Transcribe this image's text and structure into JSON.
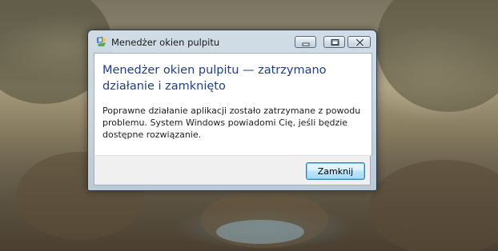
{
  "dialog": {
    "title": "Menedżer okien pulpitu",
    "heading": "Menedżer okien pulpitu — zatrzymano działanie i zamknięto",
    "message": "Poprawne działanie aplikacji zostało zatrzymane z powodu problemu. System Windows powiadomi Cię, jeśli będzie dostępne rozwiązanie.",
    "close_button_label": "Zamknij",
    "app_icon": "desktop-window-manager-icon"
  },
  "titlebar_buttons": {
    "minimize": "minimize-icon",
    "maximize": "maximize-icon",
    "close": "close-icon"
  },
  "colors": {
    "heading": "#1f3e8e",
    "button_border": "#3c7fb1"
  }
}
